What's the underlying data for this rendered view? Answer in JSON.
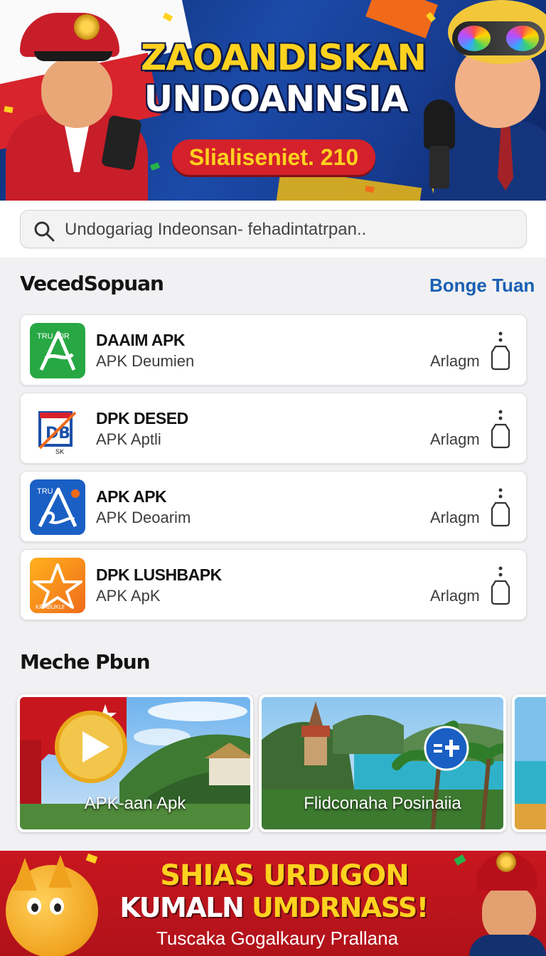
{
  "hero": {
    "title_line1": "ZAOANDISKAN",
    "title_line2": "UNDOANNSIA",
    "pill": "Slialiseniet. 210",
    "colors": {
      "title_yellow": "#ffd21f",
      "pill_red": "#d4212b",
      "background_blue": "#1b4aa8"
    }
  },
  "search": {
    "icon": "search-icon",
    "placeholder": "Undogariag Indeonsan- fehadintatrpan.."
  },
  "apps_section": {
    "title": "VecedSopuan",
    "link": "Bonge Tuan",
    "items": [
      {
        "name": "DAAIM APK",
        "subtitle": "APK Deumien",
        "action": "Arlagm",
        "icon": "green-a-app-icon",
        "icon_text": "TRU 20R"
      },
      {
        "name": "DPK DESED",
        "subtitle": "APK Aptli",
        "action": "Arlagm",
        "icon": "db-app-icon",
        "icon_text": "SK"
      },
      {
        "name": "APK APK",
        "subtitle": "APK Deoarim",
        "action": "Arlagm",
        "icon": "blue-a-app-icon",
        "icon_text": "TRU"
      },
      {
        "name": "DPK LUSHBAPK",
        "subtitle": "APK ApK",
        "action": "Arlagm",
        "icon": "star-app-icon",
        "icon_text": "KRABUKUI"
      }
    ]
  },
  "media_section": {
    "title": "Meche Pbun",
    "cards": [
      {
        "caption": "APK-aan Apk",
        "icon": "play-icon"
      },
      {
        "caption": "Flidconaha Posinaiia",
        "icon": "sign-icon"
      },
      {
        "caption": ""
      }
    ]
  },
  "bottom_banner": {
    "line1": "SHIAS URDIGON",
    "line2_a": "KUMALN",
    "line2_b": "UMDRNASS!",
    "line3": "Tuscaka Gogalkaury Prallana",
    "colors": {
      "background_red": "#c8161f",
      "headline_yellow": "#ffd21f"
    }
  },
  "accent_color": "#1a5fb4"
}
